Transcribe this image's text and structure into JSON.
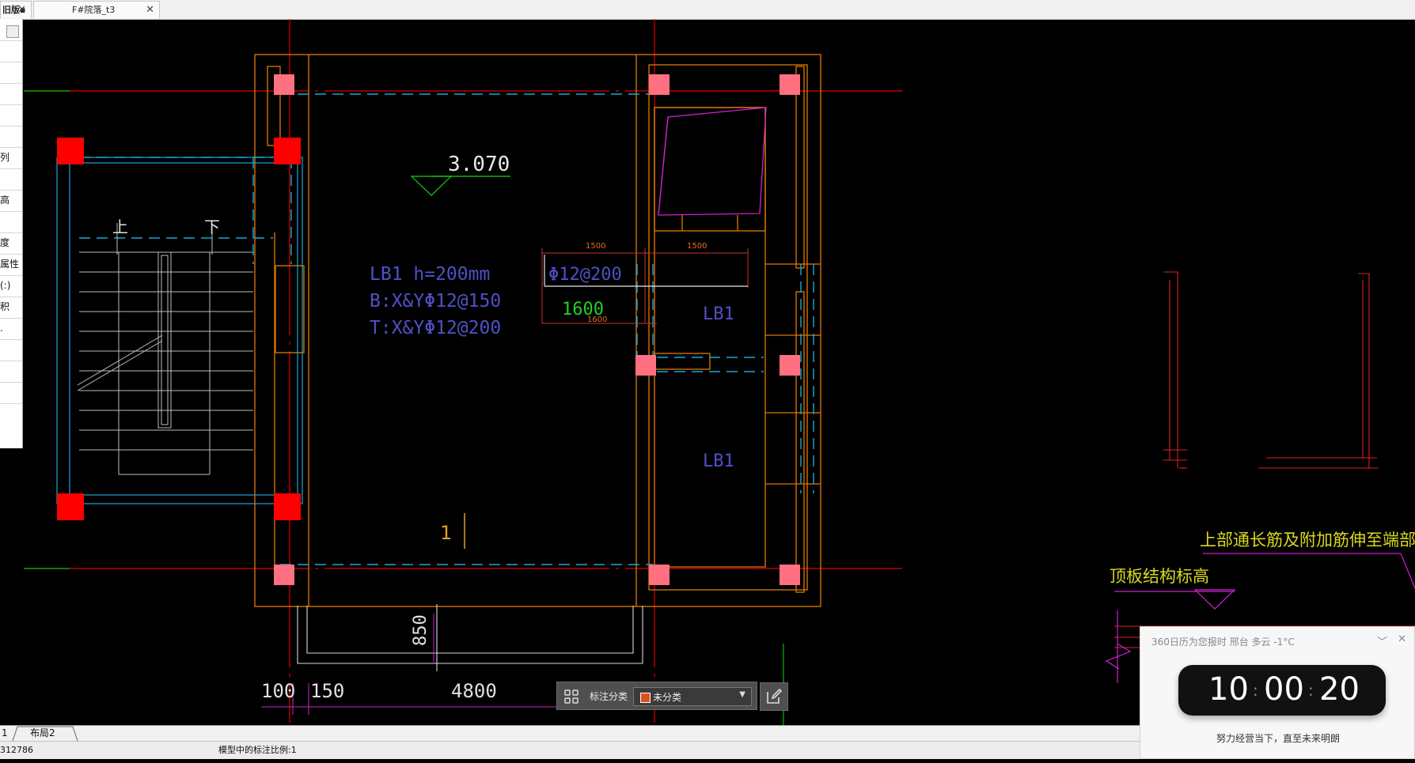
{
  "tabs": [
    {
      "label": "旧版▪"
    },
    {
      "label": "F#院落_t3"
    }
  ],
  "left_panel": {
    "items": [
      "",
      "",
      "",
      "",
      "",
      "",
      "列",
      "",
      "高",
      "",
      "度",
      "属性",
      "(:)",
      "积",
      ".",
      "",
      "",
      ""
    ]
  },
  "drawing": {
    "elevation": "3.070",
    "slab_label": "LB1 h=200mm",
    "bottom_rebar": "B:X&YΦ12@150",
    "top_rebar": "T:X&YΦ12@200",
    "rebar_label": "Φ12@200",
    "dim_1600_green": "1600",
    "dim_1600_small": "1600",
    "dim_1500_a": "1500",
    "dim_1500_b": "1500",
    "lb1_a": "LB1",
    "lb1_b": "LB1",
    "stair_up": "上",
    "stair_down": "下",
    "section_number": "1",
    "dim_850": "850",
    "dim_100": "100",
    "dim_150": "150",
    "dim_4800": "4800",
    "note_top": "上部通长筋及附加筋伸至端部",
    "note_elev": "顶板结构标高"
  },
  "float_toolbar": {
    "label": "标注分类",
    "selected": "未分类"
  },
  "layout_tabs": [
    "1",
    "布局2"
  ],
  "status": {
    "coord": "312786",
    "scale": "模型中的标注比例:1"
  },
  "popup": {
    "header": "360日历为您报时 邢台 多云 -1°C",
    "hour": "10",
    "minute": "00",
    "second": "20",
    "motto": "努力经营当下，直至未来明朗"
  }
}
